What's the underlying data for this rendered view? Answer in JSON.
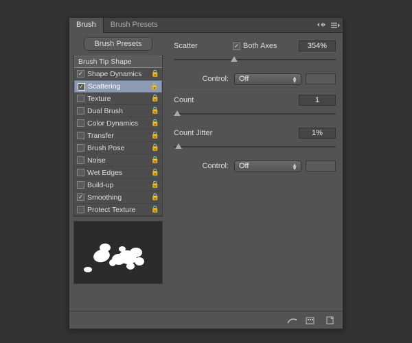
{
  "tabs": {
    "brush": "Brush",
    "presets": "Brush Presets"
  },
  "buttons": {
    "brush_presets": "Brush Presets"
  },
  "options": {
    "tip_shape": "Brush Tip Shape",
    "shape_dynamics": {
      "label": "Shape Dynamics",
      "checked": true
    },
    "scattering": {
      "label": "Scattering",
      "checked": true
    },
    "texture": {
      "label": "Texture",
      "checked": false
    },
    "dual_brush": {
      "label": "Dual Brush",
      "checked": false
    },
    "color_dynamics": {
      "label": "Color Dynamics",
      "checked": false
    },
    "transfer": {
      "label": "Transfer",
      "checked": false
    },
    "brush_pose": {
      "label": "Brush Pose",
      "checked": false
    },
    "noise": {
      "label": "Noise",
      "checked": false
    },
    "wet_edges": {
      "label": "Wet Edges",
      "checked": false
    },
    "build_up": {
      "label": "Build-up",
      "checked": false
    },
    "smoothing": {
      "label": "Smoothing",
      "checked": true
    },
    "protect_texture": {
      "label": "Protect Texture",
      "checked": false
    }
  },
  "settings": {
    "scatter_label": "Scatter",
    "both_axes_label": "Both Axes",
    "both_axes_checked": true,
    "scatter_value": "354%",
    "control_label": "Control:",
    "control1_value": "Off",
    "count_label": "Count",
    "count_value": "1",
    "count_jitter_label": "Count Jitter",
    "count_jitter_value": "1%",
    "control2_value": "Off"
  },
  "checkmark": "✓"
}
